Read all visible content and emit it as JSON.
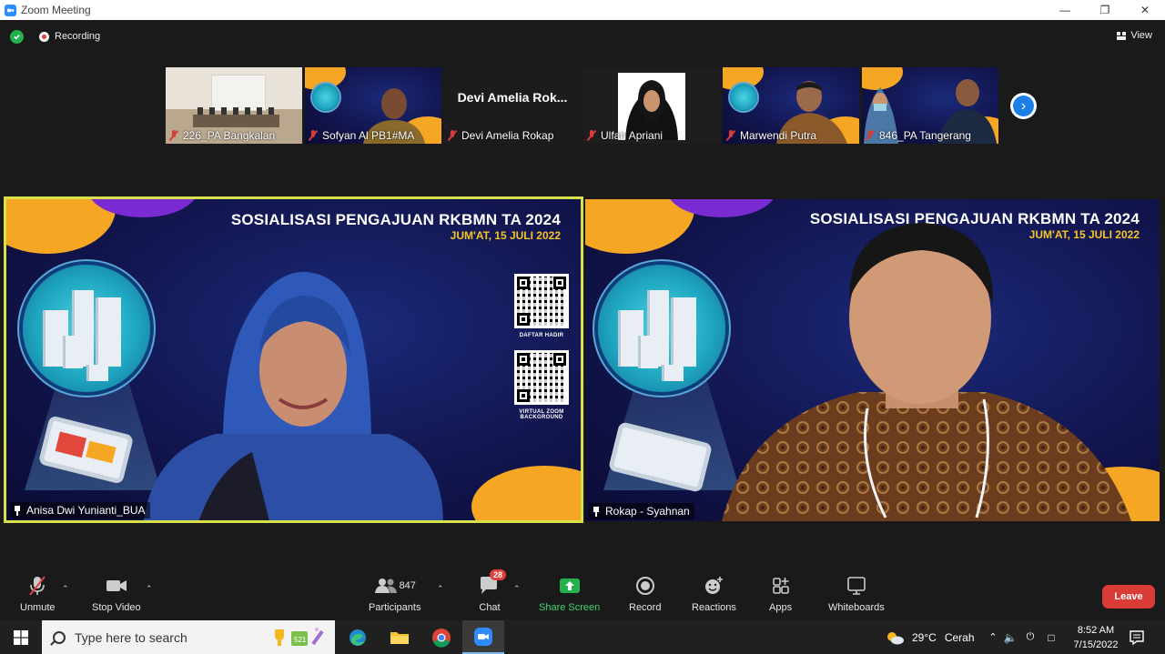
{
  "window": {
    "title": "Zoom Meeting"
  },
  "top_bar": {
    "recording_label": "Recording",
    "view_label": "View"
  },
  "thumbnails": [
    {
      "name": "226_PA Bangkalan"
    },
    {
      "name": "Sofyan Al PB1#MA"
    },
    {
      "name": "Devi Amelia Rokap",
      "card_text": "Devi Amelia Rok..."
    },
    {
      "name": "Ulfah Apriani"
    },
    {
      "name": "Marwendi Putra"
    },
    {
      "name": "846_PA Tangerang"
    }
  ],
  "slide": {
    "title": "SOSIALISASI PENGAJUAN RKBMN TA 2024",
    "date": "JUM'AT, 15 JULI 2022",
    "qr1_caption": "DAFTAR HADIR",
    "qr2_caption": "VIRTUAL ZOOM BACKGROUND"
  },
  "main_tiles": {
    "left_name": "Anisa Dwi Yunianti_BUA",
    "right_name": "Rokap - Syahnan"
  },
  "toolbar": {
    "unmute": "Unmute",
    "stop_video": "Stop Video",
    "participants": "Participants",
    "participants_count": "847",
    "chat": "Chat",
    "chat_badge": "28",
    "share_screen": "Share Screen",
    "record": "Record",
    "reactions": "Reactions",
    "apps": "Apps",
    "whiteboards": "Whiteboards",
    "leave": "Leave"
  },
  "taskbar": {
    "search_placeholder": "Type here to search",
    "weather_temp": "29°C",
    "weather_desc": "Cerah",
    "time": "8:52 AM",
    "date": "7/15/2022"
  },
  "colors": {
    "active_speaker_border": "#d8e04a",
    "share_green": "#23b14d",
    "leave_red": "#d93b36",
    "accent_orange": "#f5a623"
  }
}
